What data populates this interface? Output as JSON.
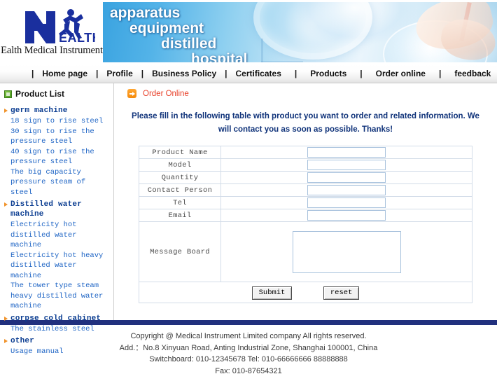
{
  "header": {
    "logo_text_top": "EALTH",
    "company_caption": "Ealth Medical Instrument",
    "banner_words": [
      "apparatus",
      "equipment",
      "distilled",
      "hospital"
    ]
  },
  "nav": {
    "separator": "|",
    "items": [
      {
        "label": "Home page"
      },
      {
        "label": "Profile"
      },
      {
        "label": "Business Policy"
      },
      {
        "label": "Certificates"
      },
      {
        "label": "Products"
      },
      {
        "label": "Order online"
      },
      {
        "label": "feedback"
      }
    ]
  },
  "sidebar": {
    "title": "Product List",
    "title_icon": "green-square-icon",
    "groups": [
      {
        "label": "germ machine",
        "items": [
          "18 sign to rise steel",
          "30 sign to rise the pressure steel",
          "40 sign to rise the pressure steel",
          "The big capacity pressure steam of steel"
        ]
      },
      {
        "label": "Distilled water machine",
        "items": [
          "Electricity hot distilled water machine",
          "Electricity hot heavy distilled water machine",
          "The tower type steam heavy distilled water machine"
        ]
      },
      {
        "label": "corpse cold cabinet",
        "items": [
          "The stainless steel"
        ]
      },
      {
        "label": "other",
        "items": [
          "Usage manual"
        ]
      }
    ]
  },
  "main": {
    "breadcrumb": "Order Online",
    "breadcrumb_icon": "orange-arrow-icon",
    "intro": "Please fill in the following table with product you want to order and related information. We will contact you as soon as possible. Thanks!",
    "form": {
      "rows": [
        {
          "label": "Product Name",
          "value": "",
          "placeholder": ""
        },
        {
          "label": "Model",
          "value": "",
          "placeholder": ""
        },
        {
          "label": "Quantity",
          "value": "",
          "placeholder": ""
        },
        {
          "label": "Contact Person",
          "value": "",
          "placeholder": ""
        },
        {
          "label": "Tel",
          "value": "",
          "placeholder": ""
        },
        {
          "label": "Email",
          "value": "",
          "placeholder": ""
        }
      ],
      "message_label": "Message Board",
      "message_value": "",
      "submit_label": "Submit",
      "reset_label": "reset"
    }
  },
  "footer": {
    "lines": [
      "Copyright @ Medical Instrument Limited company All rights reserved.",
      "Add.：No.8 Xinyuan Road, Anting Industrial Zone, Shanghai 100001, China",
      "Switchboard: 010-12345678 Tel: 010-66666666 88888888",
      "Fax: 010-87654321"
    ]
  },
  "colors": {
    "brand_blue": "#21307e",
    "link_blue": "#1c63c4",
    "group_blue": "#0b3d91",
    "accent_orange": "#f58a0b",
    "crumb_red": "#e8412a"
  }
}
